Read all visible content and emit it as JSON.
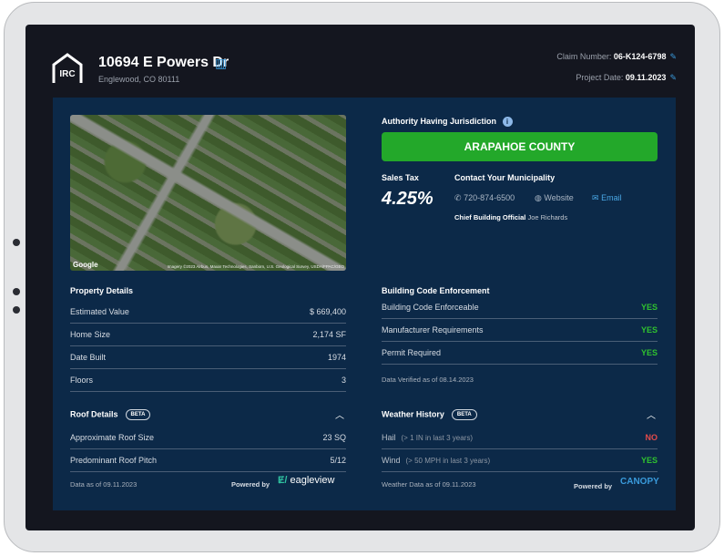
{
  "header": {
    "logo_text": "IRC",
    "address": "10694 E Powers Dr",
    "city": "Englewood, CO 80111",
    "claim_label": "Claim Number:",
    "claim_number": "06-K124-6798",
    "project_date_label": "Project Date:",
    "project_date": "09.11.2023"
  },
  "map": {
    "google": "Google",
    "attribution": "Imagery ©2023 Airbus, Maxar Technologies, Sanborn, U.S. Geological Survey, USDA/FPAC/GEO"
  },
  "jurisdiction": {
    "label": "Authority Having Jurisdiction",
    "county": "ARAPAHOE COUNTY",
    "sales_tax_label": "Sales Tax",
    "sales_tax": "4.25%",
    "contact_label": "Contact Your Municipality",
    "phone": "720-874-6500",
    "website": "Website",
    "email": "Email",
    "official_label": "Chief Building Official",
    "official_name": "Joe Richards"
  },
  "property": {
    "title": "Property Details",
    "rows": [
      {
        "label": "Estimated Value",
        "value": "$ 669,400"
      },
      {
        "label": "Home Size",
        "value": "2,174 SF"
      },
      {
        "label": "Date Built",
        "value": "1974"
      },
      {
        "label": "Floors",
        "value": "3"
      }
    ]
  },
  "enforcement": {
    "title": "Building Code Enforcement",
    "rows": [
      {
        "label": "Building Code Enforceable",
        "value": "YES"
      },
      {
        "label": "Manufacturer Requirements",
        "value": "YES"
      },
      {
        "label": "Permit Required",
        "value": "YES"
      }
    ],
    "verified": "Data Verified as of 08.14.2023"
  },
  "roof": {
    "title": "Roof Details",
    "badge": "BETA",
    "rows": [
      {
        "label": "Approximate Roof Size",
        "value": "23 SQ"
      },
      {
        "label": "Predominant Roof Pitch",
        "value": "5/12"
      }
    ],
    "data_as_of": "Data as of 09.11.2023",
    "powered_by": "Powered by",
    "brand": "eagleview"
  },
  "weather": {
    "title": "Weather History",
    "badge": "BETA",
    "rows": [
      {
        "label": "Hail",
        "note": "(> 1 IN in last 3 years)",
        "value": "NO"
      },
      {
        "label": "Wind",
        "note": "(> 50 MPH in last 3 years)",
        "value": "YES"
      }
    ],
    "data_as_of": "Weather Data as of 09.11.2023",
    "powered_by": "Powered by",
    "brand": "CANOPY"
  },
  "colors": {
    "accent": "#3a9bdc",
    "green": "#23a82a",
    "yes": "#2fc12f",
    "no": "#e44b4b",
    "panel": "#0c2948"
  }
}
